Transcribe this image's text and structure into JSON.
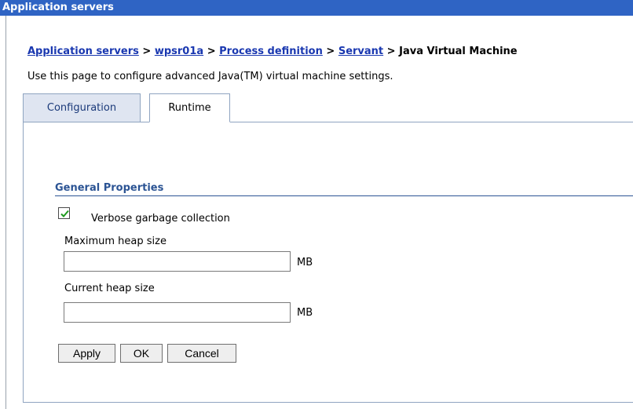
{
  "window": {
    "title": "Application servers"
  },
  "breadcrumb": {
    "items": [
      "Application servers",
      "wpsr01a",
      "Process definition",
      "Servant"
    ],
    "separator": ">",
    "current": "Java Virtual Machine"
  },
  "description": "Use this page to configure advanced Java(TM) virtual machine settings.",
  "tabs": [
    {
      "label": "Configuration",
      "active": false
    },
    {
      "label": "Runtime",
      "active": true
    }
  ],
  "general_properties": {
    "title": "General Properties",
    "verbose_gc": {
      "label": "Verbose garbage collection",
      "checked": true
    },
    "max_heap": {
      "label": "Maximum heap size",
      "value": "",
      "unit": "MB"
    },
    "current_heap": {
      "label": "Current heap size",
      "value": "",
      "unit": "MB"
    }
  },
  "buttons": {
    "apply": "Apply",
    "ok": "OK",
    "cancel": "Cancel"
  },
  "colors": {
    "titlebar": "#2f64c4",
    "link": "#1a38b0",
    "section_title": "#2c5494",
    "checkmark": "#1e9a1e"
  }
}
